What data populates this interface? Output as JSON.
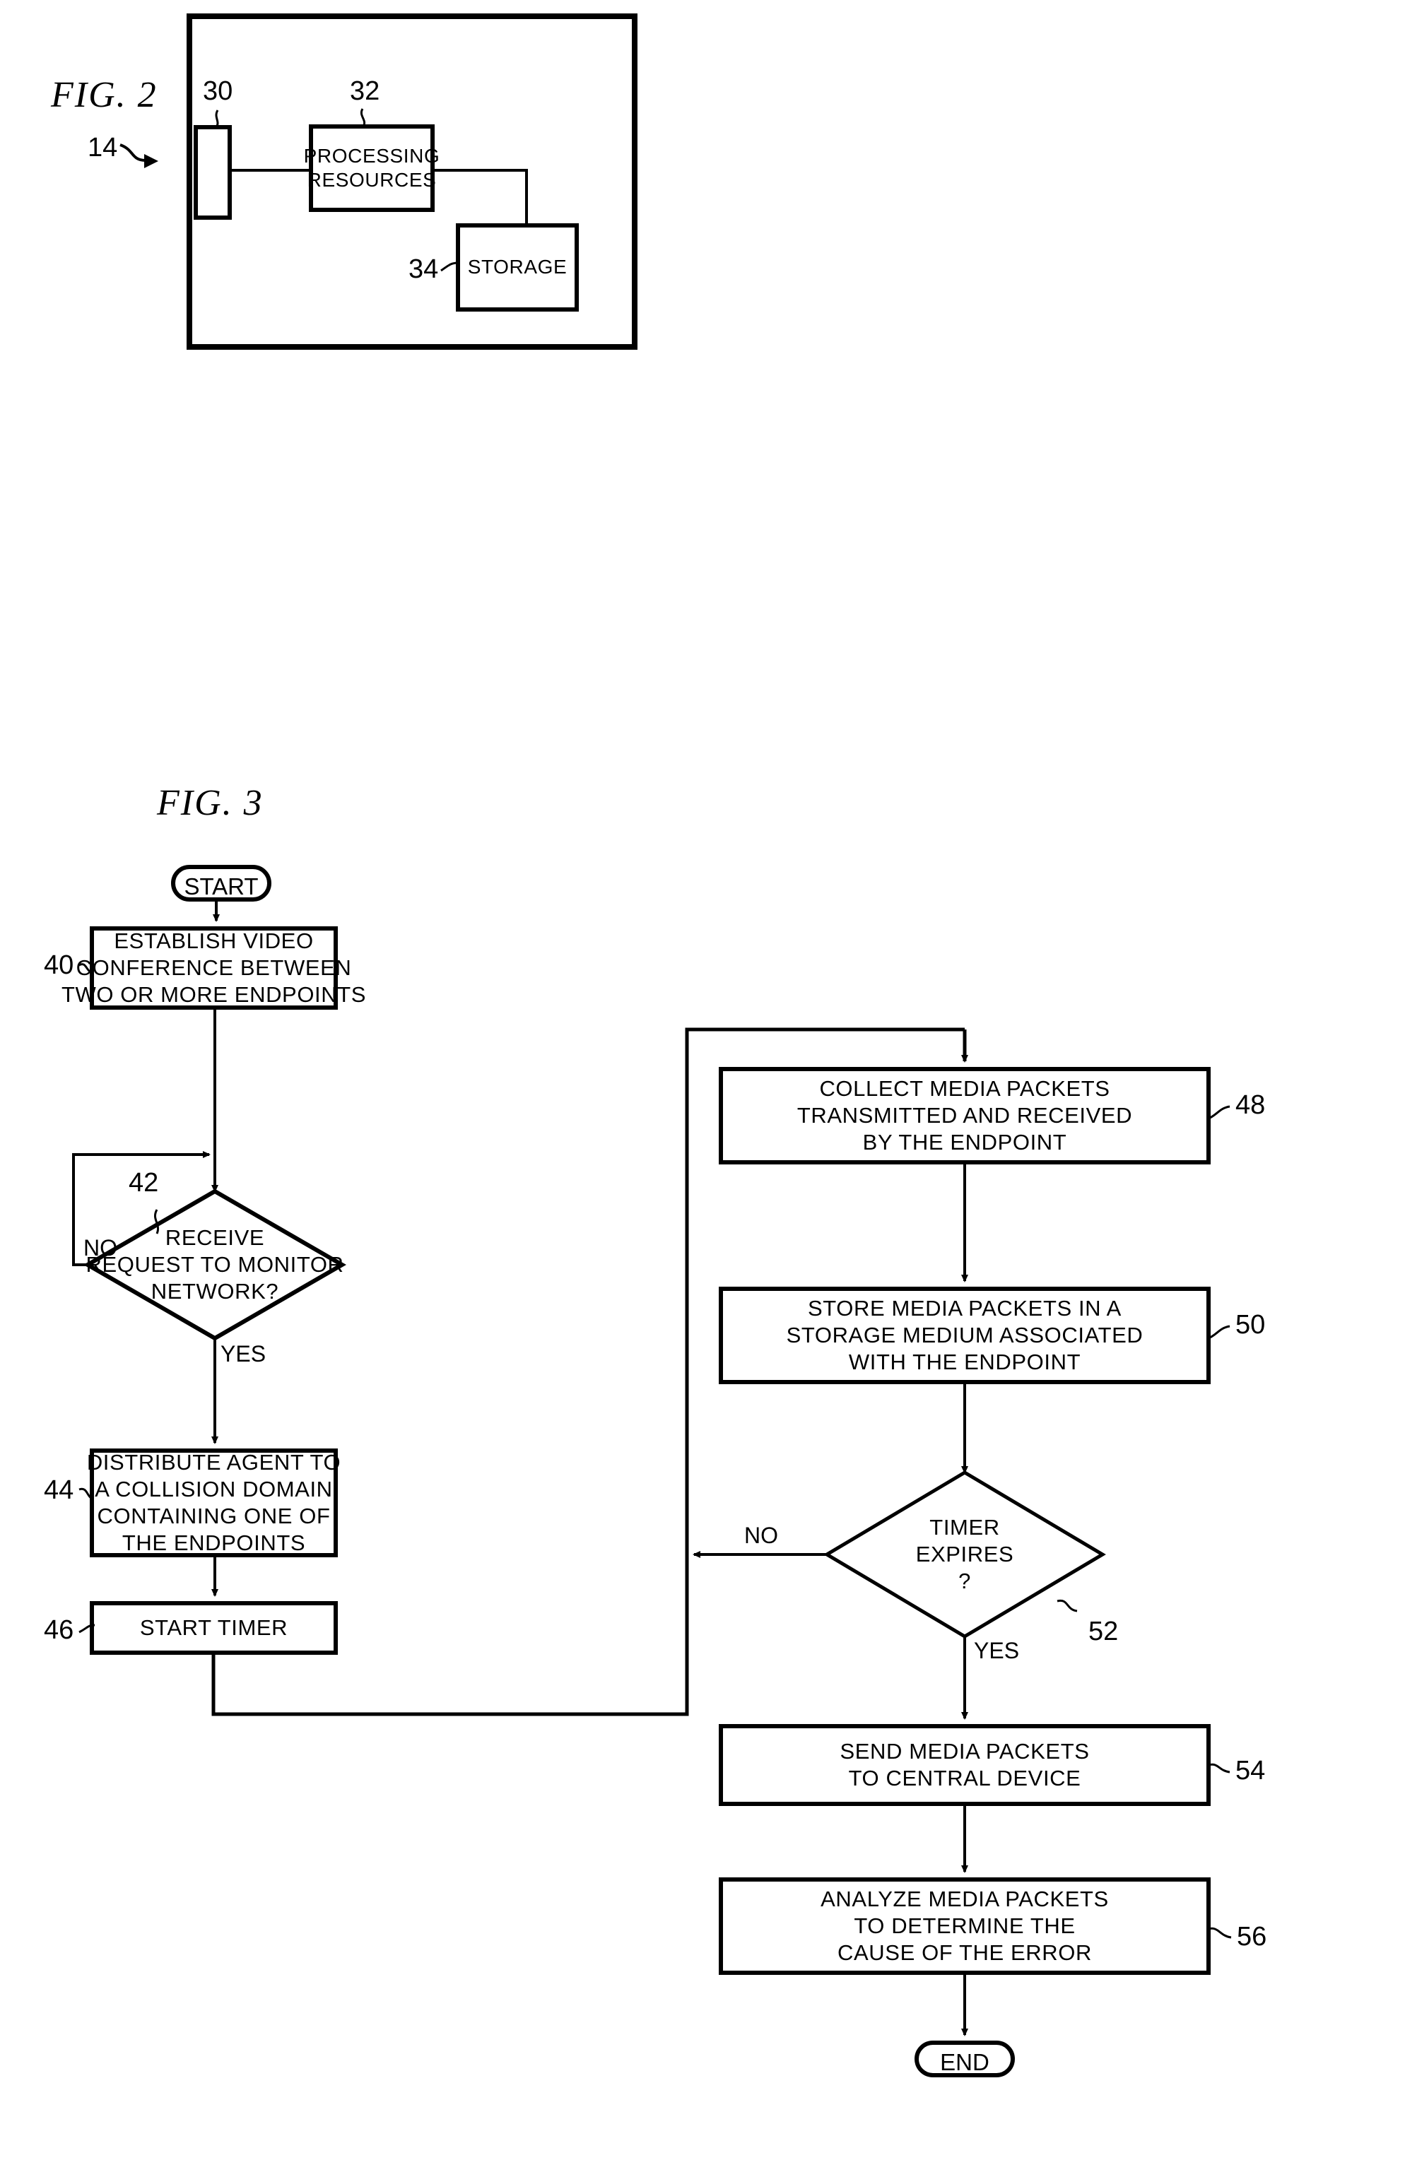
{
  "figures": [
    {
      "id": "fig2",
      "caption": "FIG.  2",
      "ref_assembly": "14",
      "blocks": [
        {
          "ref": "30",
          "label": ""
        },
        {
          "ref": "32",
          "label": "PROCESSING RESOURCES",
          "line1": "PROCESSING",
          "line2": "RESOURCES"
        },
        {
          "ref": "34",
          "label": "STORAGE",
          "line1": "STORAGE"
        }
      ]
    },
    {
      "id": "fig3",
      "caption": "FIG.  3",
      "terminals": {
        "start": "START",
        "end": "END"
      },
      "steps": [
        {
          "ref": "40",
          "type": "process",
          "lines": [
            "ESTABLISH VIDEO",
            "CONFERENCE BETWEEN",
            "TWO OR MORE ENDPOINTS"
          ]
        },
        {
          "ref": "42",
          "type": "decision",
          "lines": [
            "RECEIVE",
            "REQUEST TO MONITOR",
            "NETWORK?"
          ],
          "branch_no": "NO",
          "branch_yes": "YES"
        },
        {
          "ref": "44",
          "type": "process",
          "lines": [
            "DISTRIBUTE AGENT TO",
            "A COLLISION DOMAIN",
            "CONTAINING ONE OF",
            "THE ENDPOINTS"
          ]
        },
        {
          "ref": "46",
          "type": "process",
          "lines": [
            "START TIMER"
          ]
        },
        {
          "ref": "48",
          "type": "process",
          "lines": [
            "COLLECT MEDIA PACKETS",
            "TRANSMITTED AND RECEIVED",
            "BY THE ENDPOINT"
          ]
        },
        {
          "ref": "50",
          "type": "process",
          "lines": [
            "STORE MEDIA PACKETS IN A",
            "STORAGE MEDIUM ASSOCIATED",
            "WITH THE ENDPOINT"
          ]
        },
        {
          "ref": "52",
          "type": "decision",
          "lines": [
            "TIMER",
            "EXPIRES",
            "?"
          ],
          "branch_no": "NO",
          "branch_yes": "YES"
        },
        {
          "ref": "54",
          "type": "process",
          "lines": [
            "SEND MEDIA PACKETS",
            "TO CENTRAL DEVICE"
          ]
        },
        {
          "ref": "56",
          "type": "process",
          "lines": [
            "ANALYZE MEDIA PACKETS",
            "TO DETERMINE THE",
            "CAUSE OF THE ERROR"
          ]
        }
      ]
    }
  ],
  "colors": {
    "ink": "#000000",
    "paper": "#ffffff"
  }
}
